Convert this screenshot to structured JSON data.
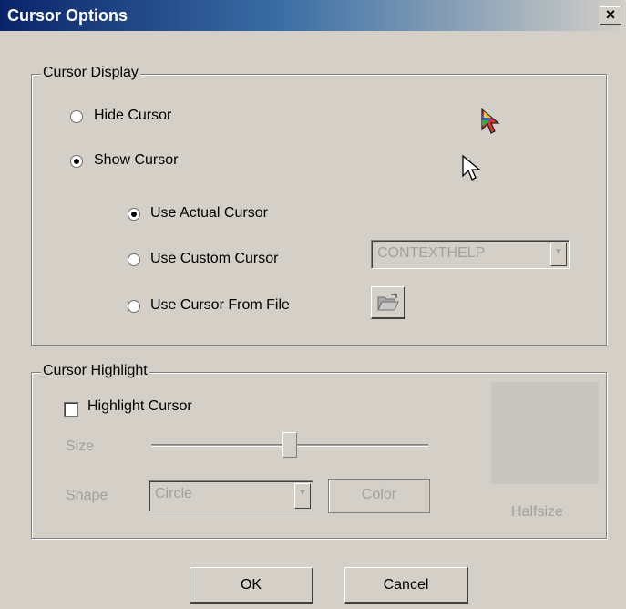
{
  "window": {
    "title": "Cursor Options",
    "close_glyph": "×"
  },
  "cursor_display": {
    "legend": "Cursor Display",
    "hide_label": "Hide Cursor",
    "show_label": "Show Cursor",
    "actual_label": "Use Actual Cursor",
    "custom_label": "Use Custom Cursor",
    "file_label": "Use Cursor From File",
    "custom_cursor_value": "CONTEXTHELP",
    "selected_display": "Show Cursor",
    "selected_source": "Use Actual Cursor",
    "dropdown_glyph": "▼"
  },
  "cursor_highlight": {
    "legend": "Cursor Highlight",
    "highlight_label": "Highlight Cursor",
    "highlight_checked": false,
    "size_label": "Size",
    "size_value": 0.5,
    "shape_label": "Shape",
    "shape_value": "Circle",
    "color_button": "Color",
    "preview_caption": "Halfsize"
  },
  "buttons": {
    "ok": "OK",
    "cancel": "Cancel"
  },
  "colors": {
    "titlebar_start": "#0a246a",
    "titlebar_end": "#d4d0c8",
    "face": "#d4d0c8"
  },
  "icons": [
    "colorful-arrow-cursor-icon",
    "arrow-cursor-icon",
    "folder-open-icon",
    "close-icon",
    "chevron-down-icon"
  ]
}
